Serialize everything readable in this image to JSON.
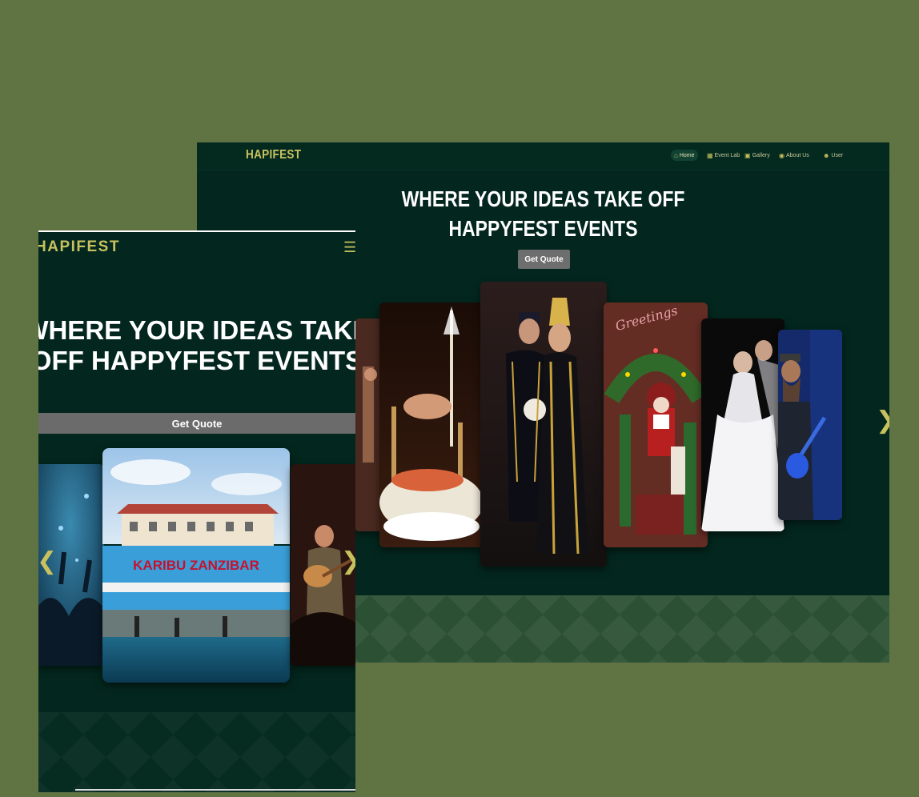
{
  "desktop": {
    "logo": "HAPIFEST",
    "nav": [
      {
        "label": "Home",
        "icon": "home-icon"
      },
      {
        "label": "Event Lab",
        "icon": "document-icon"
      },
      {
        "label": "Gallery",
        "icon": "gallery-icon"
      },
      {
        "label": "About Us",
        "icon": "info-icon"
      },
      {
        "label": "User",
        "icon": "user-icon"
      }
    ],
    "hero_line1": "WHERE YOUR IDEAS TAKE OFF",
    "hero_line2": "HAPPYFEST EVENTS",
    "cta": "Get Quote",
    "gallery_images": [
      "party-photo",
      "cake-sparkler-photo",
      "wedding-couple-photo",
      "christmas-santa-photo",
      "bride-photo",
      "guitarist-photo"
    ],
    "sign_text": "Greetings"
  },
  "mobile": {
    "logo": "HAPIFEST",
    "hero_title": "WHERE YOUR IDEAS TAKE OFF HAPPYFEST EVENTS",
    "cta": "Get Quote",
    "sign_text": "KARIBU ZANZIBAR",
    "gallery_images": [
      "concert-crowd-photo",
      "karibu-zanzibar-photo",
      "guitarist-photo"
    ]
  },
  "colors": {
    "background": "#5f7442",
    "panel": "#03271e",
    "accent": "#c8c25e",
    "button": "#6e6e6e"
  }
}
